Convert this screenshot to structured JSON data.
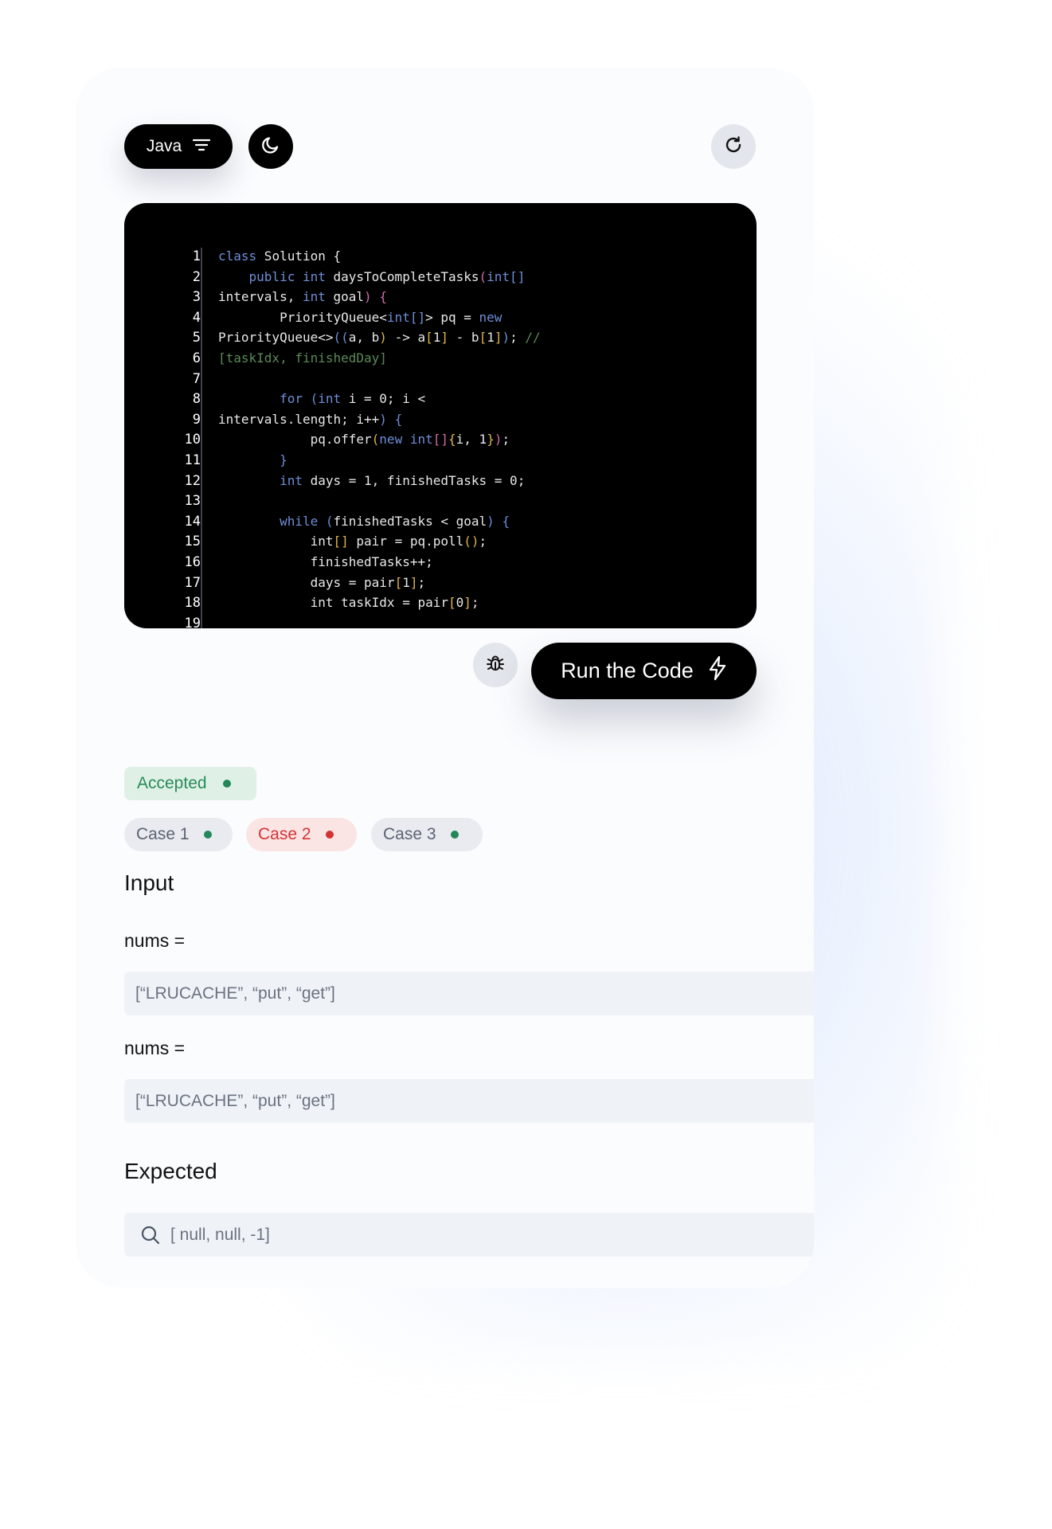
{
  "toolbar": {
    "language": "Java",
    "icons": [
      "filter-icon",
      "moon-icon",
      "refresh-icon"
    ]
  },
  "editor": {
    "line_numbers": [
      "1",
      "2",
      "3",
      "4",
      "5",
      "6",
      "7",
      "8",
      "9",
      "10",
      "11",
      "12",
      "13",
      "14",
      "15",
      "16",
      "17",
      "18",
      "19"
    ]
  },
  "actions": {
    "run_label": "Run the Code",
    "icons": [
      "bug-icon",
      "lightning-icon"
    ]
  },
  "result": {
    "status": "Accepted",
    "status_color": "#2a8a58",
    "cases": [
      {
        "label": "Case 1",
        "state": "pass"
      },
      {
        "label": "Case 2",
        "state": "fail"
      },
      {
        "label": "Case 3",
        "state": "pass"
      }
    ]
  },
  "input": {
    "title": "Input",
    "fields": [
      {
        "label": "nums =",
        "value": "[“LRUCACHE”, “put”, “get”]"
      },
      {
        "label": "nums =",
        "value": "[“LRUCACHE”, “put”, “get”]"
      }
    ]
  },
  "expected": {
    "title": "Expected",
    "value": "[ null, null, -1]"
  },
  "colors": {
    "pass": "#23875a",
    "fail": "#d43333",
    "accent": "#000000"
  }
}
